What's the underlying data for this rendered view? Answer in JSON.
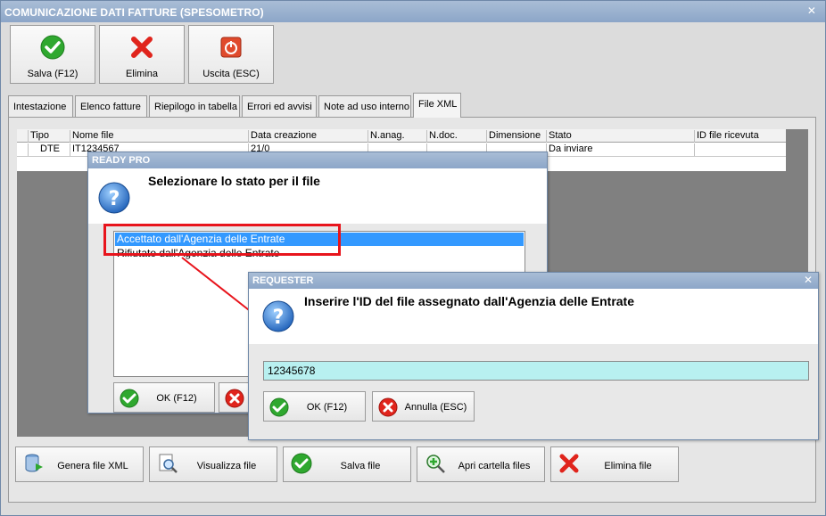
{
  "window": {
    "title": "COMUNICAZIONE DATI FATTURE (SPESOMETRO)"
  },
  "toolbar": {
    "save_label": "Salva (F12)",
    "delete_label": "Elimina",
    "exit_label": "Uscita (ESC)"
  },
  "tabs": [
    "Intestazione",
    "Elenco fatture",
    "Riepilogo in tabella",
    "Errori ed avvisi",
    "Note ad uso interno",
    "File XML"
  ],
  "grid": {
    "headers": [
      "Tipo",
      "Nome file",
      "Data creazione",
      "N.anag.",
      "N.doc.",
      "Dimensione",
      "Stato",
      "ID file ricevuta"
    ],
    "row": [
      "DTE",
      "IT1234567",
      "21/0",
      "",
      "",
      "",
      "Da inviare",
      ""
    ]
  },
  "bottom_buttons": {
    "generate": "Genera file XML",
    "view": "Visualizza file",
    "save": "Salva file",
    "open_folder": "Apri cartella files",
    "delete": "Elimina file"
  },
  "ready_dialog": {
    "title": "READY PRO",
    "message": "Selezionare lo stato per il file",
    "options": [
      "Accettato dall'Agenzia delle Entrate",
      "Rifiutato dall'Agenzia delle Entrate"
    ],
    "ok_label": "OK (F12)"
  },
  "requester_dialog": {
    "title": "REQUESTER",
    "message": "Inserire l'ID del file assegnato dall'Agenzia delle Entrate",
    "input_value": "12345678",
    "ok_label": "OK (F12)",
    "cancel_label": "Annulla (ESC)"
  },
  "colors": {
    "title_bar": "#8ca6c8",
    "accent_green": "#2fa82f",
    "accent_red": "#e0241c",
    "highlight": "#e8141c",
    "input_bg": "#b8f0f0",
    "selection": "#3399ff"
  }
}
